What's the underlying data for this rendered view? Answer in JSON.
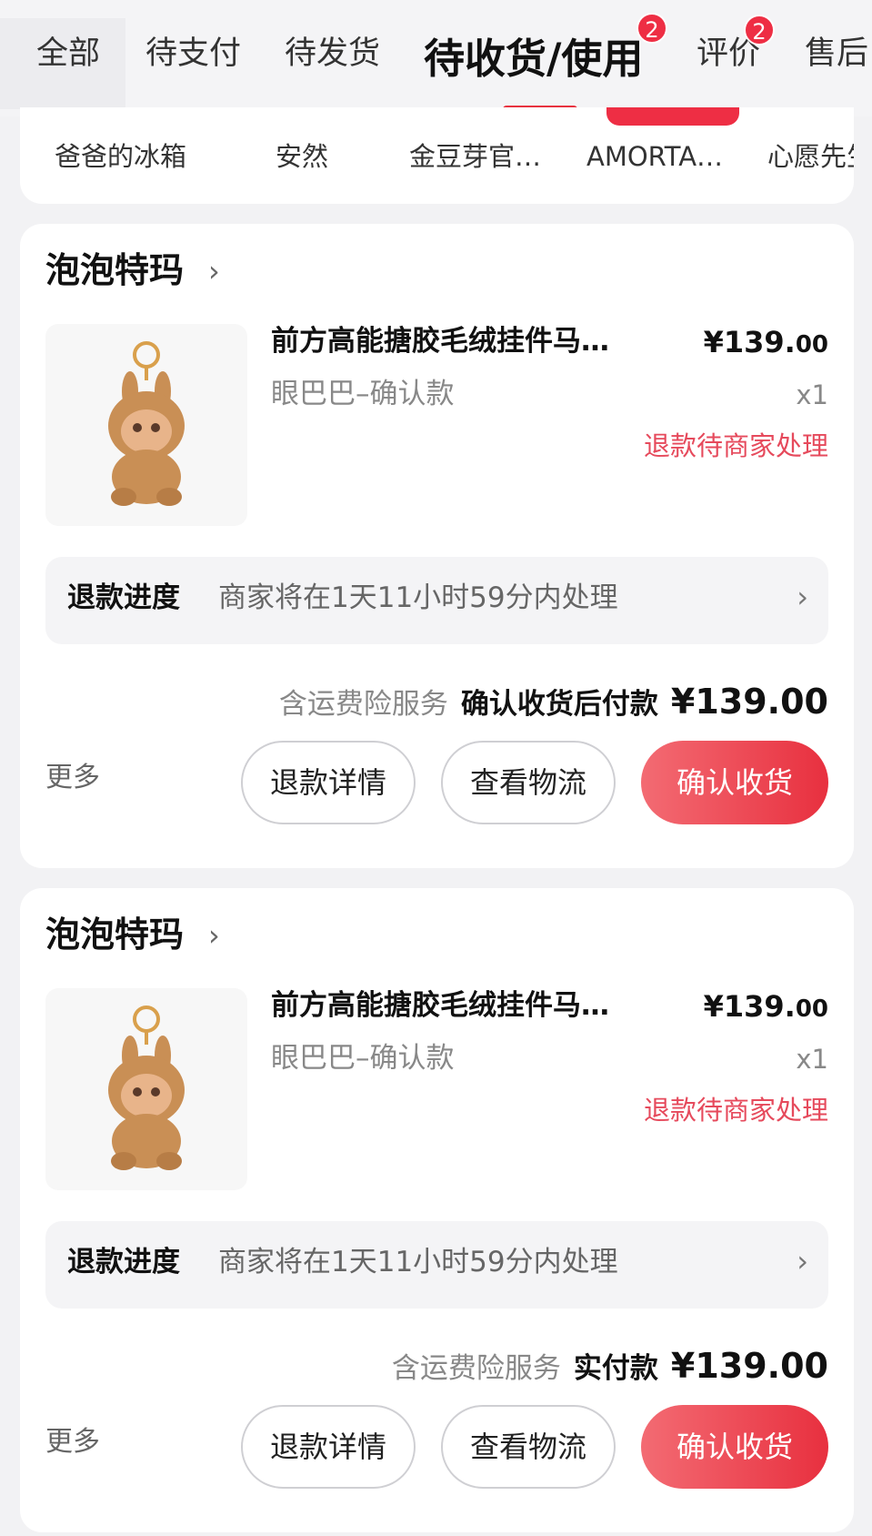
{
  "tabs": {
    "all": "全部",
    "to_pay": "待支付",
    "to_ship": "待发货",
    "to_receive": "待收货/使用",
    "review": "评价",
    "after_sale": "售后",
    "to_receive_badge": "2",
    "review_badge": "2"
  },
  "shop_filter": [
    "爸爸的冰箱",
    "安然",
    "金豆芽官…",
    "AMORTA…",
    "心愿先生"
  ],
  "orders": [
    {
      "shop": "泡泡特玛",
      "title": "前方高能搪胶毛绒挂件马…",
      "price_int": "¥139.",
      "price_dec": "00",
      "sku": "眼巴巴–确认款",
      "qty": "x1",
      "refund_status": "退款待商家处理",
      "progress_title": "退款进度",
      "progress_text": "商家将在1天11小时59分内处理",
      "service": "含运费险服务",
      "pay_label": "确认收货后付款",
      "amount": "¥139.00",
      "more": "更多",
      "btn_refund": "退款详情",
      "btn_logistics": "查看物流",
      "btn_confirm": "确认收货"
    },
    {
      "shop": "泡泡特玛",
      "title": "前方高能搪胶毛绒挂件马…",
      "price_int": "¥139.",
      "price_dec": "00",
      "sku": "眼巴巴–确认款",
      "qty": "x1",
      "refund_status": "退款待商家处理",
      "progress_title": "退款进度",
      "progress_text": "商家将在1天11小时59分内处理",
      "service": "含运费险服务",
      "pay_label": "实付款",
      "amount": "¥139.00",
      "more": "更多",
      "btn_refund": "退款详情",
      "btn_logistics": "查看物流",
      "btn_confirm": "确认收货"
    }
  ],
  "colors": {
    "accent": "#e8303f",
    "refund_status": "#e64a5c",
    "background": "#f2f2f4"
  }
}
